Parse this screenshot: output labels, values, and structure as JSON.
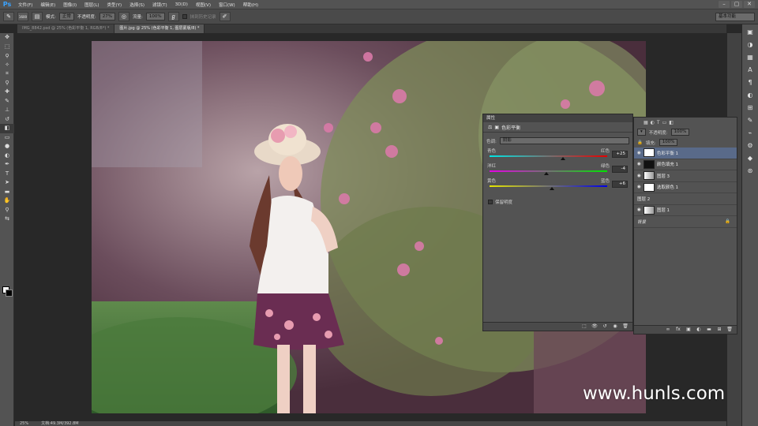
{
  "app": {
    "logo": "Ps"
  },
  "menu": [
    "文件(F)",
    "编辑(E)",
    "图像(I)",
    "图层(L)",
    "类型(Y)",
    "选择(S)",
    "滤镜(T)",
    "3D(D)",
    "视图(V)",
    "窗口(W)",
    "帮助(H)"
  ],
  "window_controls": [
    "–",
    "▢",
    "✕"
  ],
  "options": {
    "size": "1600",
    "mode_label": "模式:",
    "mode_value": "正常",
    "opacity_label": "不透明度:",
    "opacity_value": "27%",
    "flow_label": "流量:",
    "flow_value": "100%",
    "history_label": "抹到历史记录",
    "workspace": "基本功能"
  },
  "tabs": [
    {
      "label": "IMG_8842.psd @ 25% (色彩平衡 1, RGB/8*) *"
    },
    {
      "label": "图片.jpg @ 25% (色彩平衡 1, 图层蒙版/8) *"
    }
  ],
  "properties": {
    "header": "属性",
    "title": "色彩平衡",
    "tone_label": "色调:",
    "tone_value": "阴影",
    "sliders": [
      {
        "left": "青色",
        "right": "红色",
        "value": 25
      },
      {
        "left": "洋红",
        "right": "绿色",
        "value": -4
      },
      {
        "left": "黄色",
        "right": "蓝色",
        "value": 6
      }
    ],
    "slider_display": [
      "+25",
      "-4",
      "+6"
    ],
    "preserve_label": "保留明度"
  },
  "layers": {
    "opacity_label": "不透明度:",
    "opacity_value": "100%",
    "fill_label": "填充:",
    "fill_value": "100%",
    "items": [
      {
        "name": "色彩平衡 1",
        "selected": true,
        "thumb": "white"
      },
      {
        "name": "颜色填充 1",
        "selected": false,
        "thumb": "dark"
      },
      {
        "name": "图层 3",
        "selected": false,
        "thumb": "photo"
      },
      {
        "name": "选取颜色 1",
        "selected": false,
        "thumb": "white"
      },
      {
        "name": "图层 2",
        "selected": false,
        "thumb": "none"
      },
      {
        "name": "图层 1",
        "selected": false,
        "thumb": "photo"
      },
      {
        "name": "背景",
        "selected": false,
        "thumb": "none"
      }
    ]
  },
  "status": {
    "zoom": "25%",
    "doc": "文档:49.3M/392.8M"
  },
  "watermark": "www.hunls.com"
}
